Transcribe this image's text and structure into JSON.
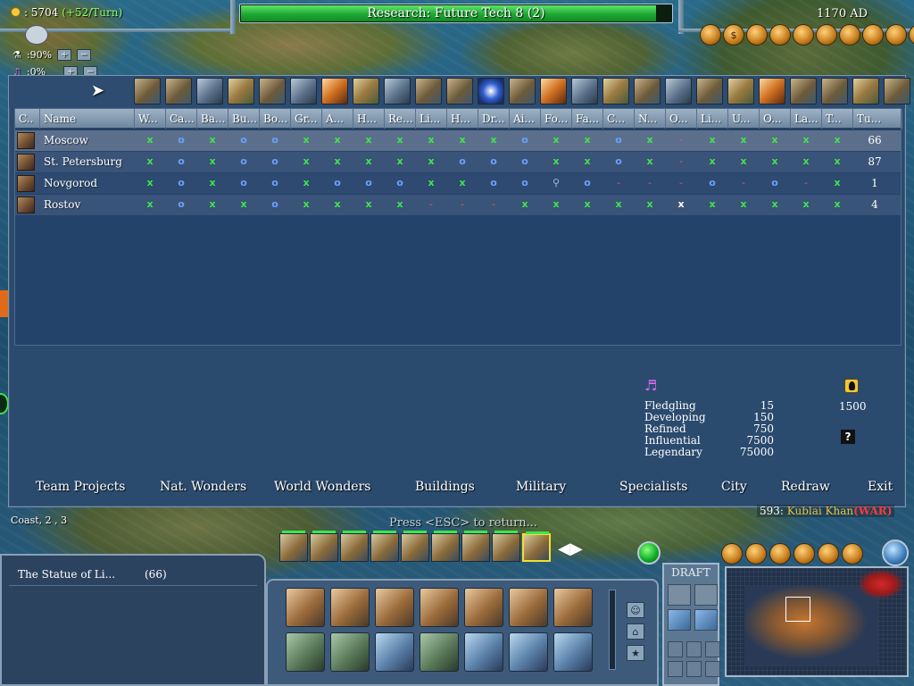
{
  "hud": {
    "gold": "5704",
    "gold_rate": "(+52/Turn)",
    "gold_prefix": ": ",
    "science_rate": ":90%",
    "culture_rate": ":0%",
    "research": "Research: Future Tech 8 (2)",
    "research_progress": 0.96,
    "date": "1170 AD",
    "advisors": [
      "domestic-icon",
      "finance-icon",
      "civics-icon",
      "foreign-icon",
      "military-icon",
      "tech-icon",
      "religion-icon",
      "corporation-icon",
      "victory-icon",
      "info-icon"
    ]
  },
  "panel": {
    "columns": [
      "C..",
      "Name",
      "W...",
      "Ca...",
      "Ba...",
      "Bu...",
      "Bo...",
      "Gr...",
      "A...",
      "H...",
      "Re...",
      "Li...",
      "H...",
      "Dr...",
      "Ai...",
      "Fo...",
      "Fa...",
      "C...",
      "N...",
      "O...",
      "Li...",
      "U...",
      "O...",
      "La...",
      "T...",
      "Tu..."
    ],
    "cities": [
      {
        "name": "Moscow",
        "cells": [
          "x",
          "o",
          "x",
          "o",
          "o",
          "x",
          "x",
          "x",
          "x",
          "x",
          "x",
          "x",
          "o",
          "x",
          "x",
          "o",
          "x",
          "-",
          "x",
          "x",
          "x",
          "x",
          "x"
        ],
        "turns": "66"
      },
      {
        "name": "St. Petersburg",
        "cells": [
          "x",
          "o",
          "x",
          "o",
          "o",
          "x",
          "x",
          "x",
          "x",
          "x",
          "o",
          "o",
          "o",
          "x",
          "x",
          "o",
          "x",
          "-",
          "x",
          "x",
          "x",
          "x",
          "x"
        ],
        "turns": "87"
      },
      {
        "name": "Novgorod",
        "cells": [
          "x",
          "o",
          "x",
          "o",
          "o",
          "x",
          "o",
          "o",
          "o",
          "x",
          "x",
          "o",
          "o",
          "m",
          "o",
          "-",
          "-",
          "-",
          "o",
          "-",
          "o",
          "-",
          "x"
        ],
        "turns": "1"
      },
      {
        "name": "Rostov",
        "cells": [
          "x",
          "o",
          "x",
          "x",
          "o",
          "x",
          "x",
          "x",
          "x",
          "-",
          "-",
          "-",
          "x",
          "x",
          "x",
          "x",
          "x",
          "w",
          "x",
          "x",
          "x",
          "x",
          "x"
        ],
        "turns": "4"
      }
    ],
    "specialist_levels": [
      {
        "label": "Fledgling",
        "value": "15"
      },
      {
        "label": "Developing",
        "value": "150"
      },
      {
        "label": "Refined",
        "value": "750"
      },
      {
        "label": "Influential",
        "value": "7500"
      },
      {
        "label": "Legendary",
        "value": "75000"
      }
    ],
    "great_people_value": "1500",
    "tabs": [
      "Team Projects",
      "Nat. Wonders",
      "World Wonders",
      "Buildings",
      "Military",
      "Specialists",
      "City",
      "Redraw",
      "Exit"
    ]
  },
  "lower": {
    "press_esc": "Press <ESC> to return...",
    "war_prefix": "593: ",
    "war_leader": "Kublai Khan",
    "war_status": "(WAR)",
    "coast": "Coast, 2 , 3",
    "selected_wonder": "The Statue of Li...",
    "selected_wonder_turns": "(66)",
    "draft_label": "DRAFT"
  }
}
